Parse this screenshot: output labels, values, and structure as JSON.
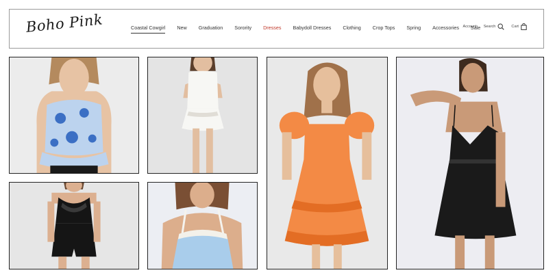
{
  "brand": {
    "logo_text": "Boho Pink"
  },
  "nav": {
    "items": [
      {
        "label": "Coastal Cowgirl"
      },
      {
        "label": "New"
      },
      {
        "label": "Graduation"
      },
      {
        "label": "Sorority"
      },
      {
        "label": "Dresses"
      },
      {
        "label": "Babydoll Dresses"
      },
      {
        "label": "Clothing"
      },
      {
        "label": "Crop Tops"
      },
      {
        "label": "Spring"
      },
      {
        "label": "Accessories"
      },
      {
        "label": "Sale"
      }
    ],
    "active_index": 0,
    "highlight_index": 4,
    "highlight_color": "#c0392b"
  },
  "utility": {
    "account_label": "Account",
    "search_label": "Search",
    "cart_label": "Cart"
  },
  "products": [
    {
      "name": "blue-floral-corset-top",
      "bg": "#ececec",
      "garment": "#bcd3ee",
      "accent": "#3b6fc4"
    },
    {
      "name": "white-strapless-mini-dress",
      "bg": "#e4e4e4",
      "garment": "#f7f7f4",
      "accent": "#e0ddd6"
    },
    {
      "name": "orange-puff-sleeve-cutout-dress",
      "bg": "#e9e9e9",
      "garment": "#f38a45",
      "accent": "#e36d24"
    },
    {
      "name": "black-slip-mini-dress",
      "bg": "#ededf2",
      "garment": "#1a1a1a",
      "accent": "#333333"
    },
    {
      "name": "black-cowl-neck-satin-romper",
      "bg": "#e6e6e6",
      "garment": "#151515",
      "accent": "#3a3a3a"
    },
    {
      "name": "light-blue-lace-trim-top",
      "bg": "#eceef3",
      "garment": "#a9cdeb",
      "accent": "#f3f1ea"
    }
  ]
}
